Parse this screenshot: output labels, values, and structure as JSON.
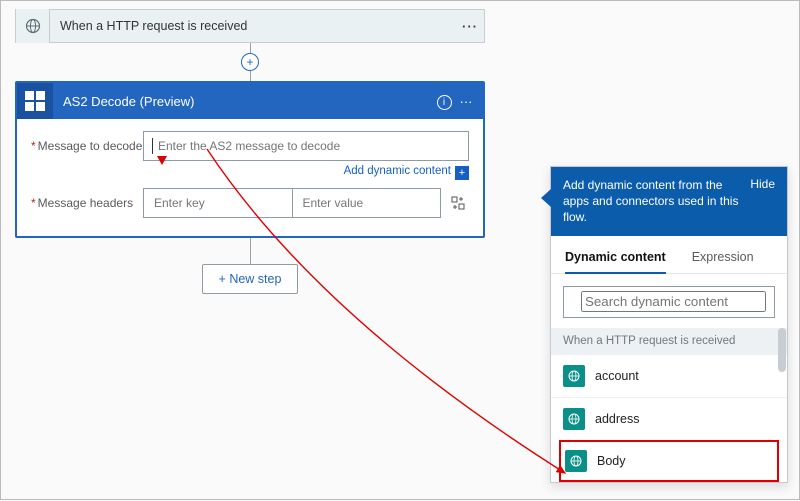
{
  "trigger": {
    "title": "When a HTTP request is received"
  },
  "action": {
    "title": "AS2 Decode  (Preview)",
    "fields": {
      "message_label": "Message to decode",
      "message_placeholder": "Enter the AS2 message to decode",
      "headers_label": "Message headers",
      "key_placeholder": "Enter key",
      "value_placeholder": "Enter value"
    },
    "add_dynamic": "Add dynamic content"
  },
  "newstep": "+ New step",
  "flyout": {
    "header": "Add dynamic content from the apps and connectors used in this flow.",
    "hide": "Hide",
    "tabs": {
      "dynamic": "Dynamic content",
      "expression": "Expression"
    },
    "search_placeholder": "Search dynamic content",
    "group": "When a HTTP request is received",
    "items": [
      "account",
      "address",
      "Body"
    ]
  }
}
